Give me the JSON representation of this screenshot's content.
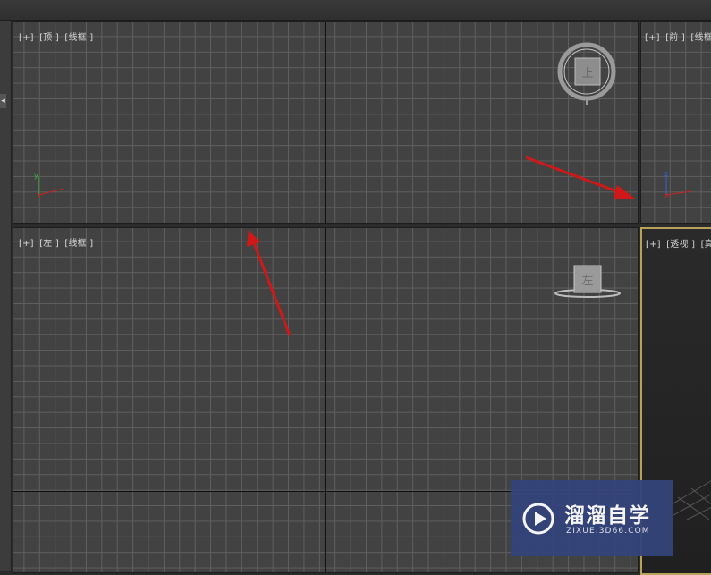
{
  "viewports": {
    "top": {
      "plus": "[+]",
      "name": "[顶 ]",
      "mode": "[线框 ]",
      "cube_label": "上"
    },
    "front": {
      "plus": "[+]",
      "name": "[前 ]",
      "mode": "[线框"
    },
    "left": {
      "plus": "[+]",
      "name": "[左 ]",
      "mode": "[线框 ]",
      "cube_label": "左"
    },
    "perspective": {
      "plus": "[+]",
      "name": "[透视 ]",
      "mode": "[真"
    }
  },
  "axis_labels": {
    "x": "x",
    "y": "y",
    "z": "z"
  },
  "watermark": {
    "title": "溜溜自学",
    "url": "ZIXUE.3D66.COM"
  },
  "colors": {
    "annotation_arrow": "#d01818",
    "active_viewport_border": "#b8a25a",
    "watermark_bg": "#34447a"
  }
}
